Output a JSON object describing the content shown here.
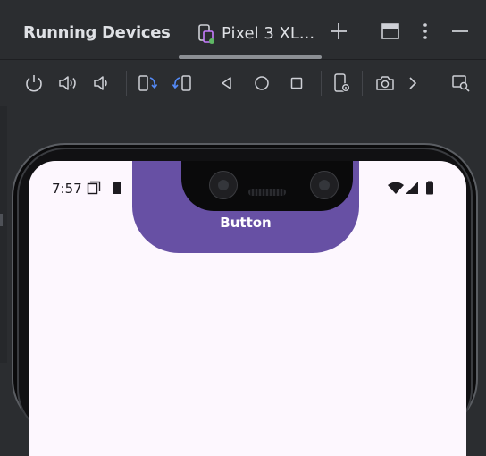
{
  "window": {
    "title": "Running Devices",
    "tab_label": "Pixel 3 XL..."
  },
  "icons": {
    "tab_device": "device-mirroring-icon",
    "add": "plus-icon",
    "layout": "window-layout-icon",
    "more": "more-vertical-icon",
    "minimize": "minimize-icon",
    "toolbar": [
      "power-icon",
      "volume-up-icon",
      "volume-down-icon",
      "rotate-left-icon",
      "rotate-right-icon",
      "back-icon",
      "home-icon",
      "overview-icon",
      "device-settings-icon",
      "camera-icon",
      "chevron-right-icon",
      "search-window-icon"
    ]
  },
  "device": {
    "status_time": "7:57",
    "button_label": "Button"
  },
  "colors": {
    "ide_background": "#2b2d30",
    "screen_background": "#fdf7fe",
    "button": "#6750a4",
    "tab_indicator_green": "#5fb865"
  }
}
